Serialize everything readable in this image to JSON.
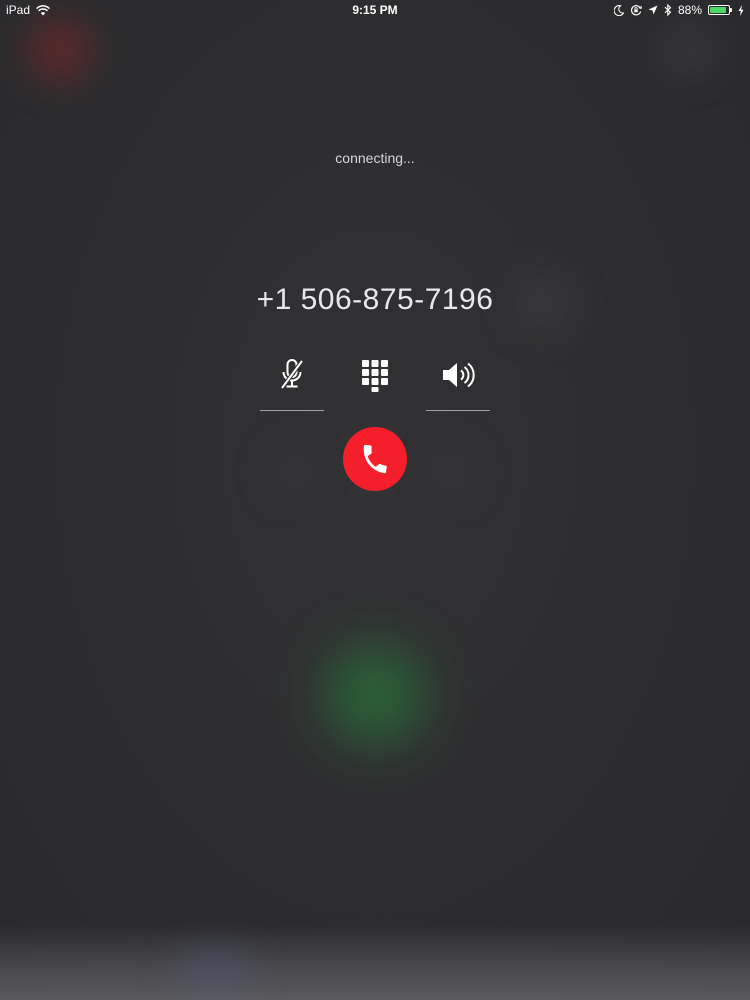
{
  "status_bar": {
    "device": "iPad",
    "time": "9:15 PM",
    "battery_percent": "88%",
    "battery_level": 0.88,
    "icons": [
      "wifi-icon",
      "moon-icon",
      "rotation-lock-icon",
      "location-arrow-icon",
      "bluetooth-icon",
      "battery-icon",
      "charging-bolt-icon"
    ]
  },
  "call": {
    "status": "connecting...",
    "number": "+1 506-875-7196"
  },
  "controls": {
    "mute_icon": "microphone-muted-icon",
    "keypad_icon": "keypad-grid-icon",
    "speaker_icon": "speaker-icon",
    "end_call_icon": "phone-hangup-icon"
  },
  "colors": {
    "background": "#2e2e30",
    "end_call": "#f41f2a",
    "battery_fill": "#4cd964",
    "text": "#ffffff"
  }
}
